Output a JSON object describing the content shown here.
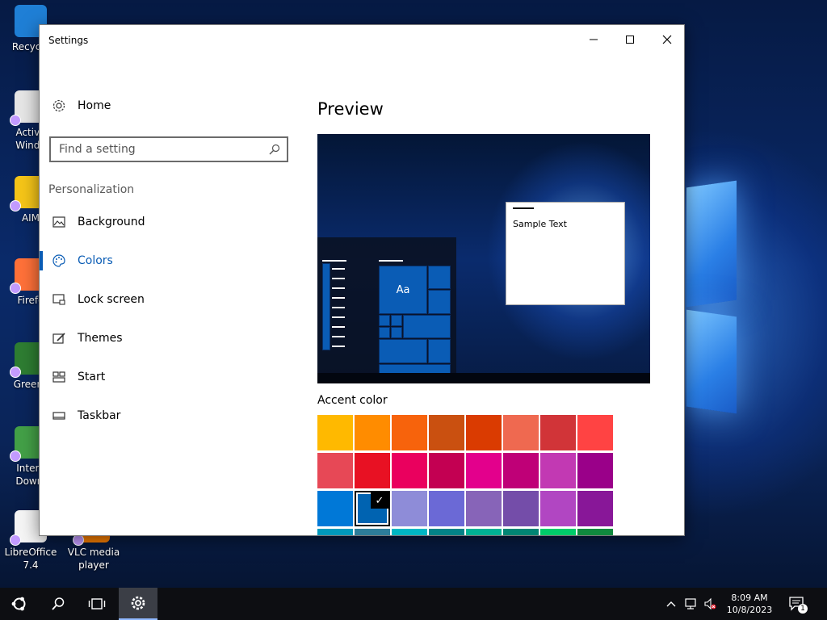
{
  "desktop": {
    "icons": [
      {
        "label": "Recycle",
        "color": "#1f7fd6"
      },
      {
        "label": "Activa\nWindo",
        "color": "#e6e6e6"
      },
      {
        "label": "AIM",
        "color": "#f5c518"
      },
      {
        "label": "Firefo",
        "color": "#ff7139"
      },
      {
        "label": "Greens",
        "color": "#2e7d32"
      },
      {
        "label": "Intern\nDownl",
        "color": "#43a047"
      },
      {
        "label": "LibreOffice\n7.4",
        "color": "#f5f5f5"
      },
      {
        "label": "VLC media\nplayer",
        "color": "#f57c00"
      }
    ]
  },
  "window": {
    "title": "Settings",
    "minimize_glyph": "—",
    "maximize_glyph": "☐",
    "close_glyph": "✕"
  },
  "sidebar": {
    "home_label": "Home",
    "search_placeholder": "Find a setting",
    "section_label": "Personalization",
    "items": [
      {
        "label": "Background",
        "icon": "image-icon"
      },
      {
        "label": "Colors",
        "icon": "palette-icon",
        "active": true
      },
      {
        "label": "Lock screen",
        "icon": "lock-screen-icon"
      },
      {
        "label": "Themes",
        "icon": "themes-icon"
      },
      {
        "label": "Start",
        "icon": "start-icon"
      },
      {
        "label": "Taskbar",
        "icon": "taskbar-icon"
      }
    ]
  },
  "content": {
    "preview_heading": "Preview",
    "sample_text": "Sample Text",
    "tile_text": "Aa",
    "accent_label": "Accent color",
    "accent_colors": [
      [
        "#ffb900",
        "#ff8c00",
        "#f7630c",
        "#ca5010",
        "#da3b01",
        "#ef6950",
        "#d13438",
        "#ff4343"
      ],
      [
        "#e74856",
        "#e81123",
        "#ea005e",
        "#c30052",
        "#e3008c",
        "#bf0077",
        "#c239b3",
        "#9a0089"
      ],
      [
        "#0078d7",
        "#0063b1",
        "#8e8cd8",
        "#6b69d6",
        "#8764b8",
        "#744da9",
        "#b146c2",
        "#881798"
      ],
      [
        "#0099bc",
        "#2d7d9a",
        "#00b7c3",
        "#038387",
        "#00b294",
        "#018574",
        "#00cc6a",
        "#10893e"
      ]
    ],
    "selected": {
      "row": 2,
      "col": 1
    }
  },
  "taskbar": {
    "time": "8:09 AM",
    "date": "10/8/2023",
    "notification_count": "1"
  }
}
